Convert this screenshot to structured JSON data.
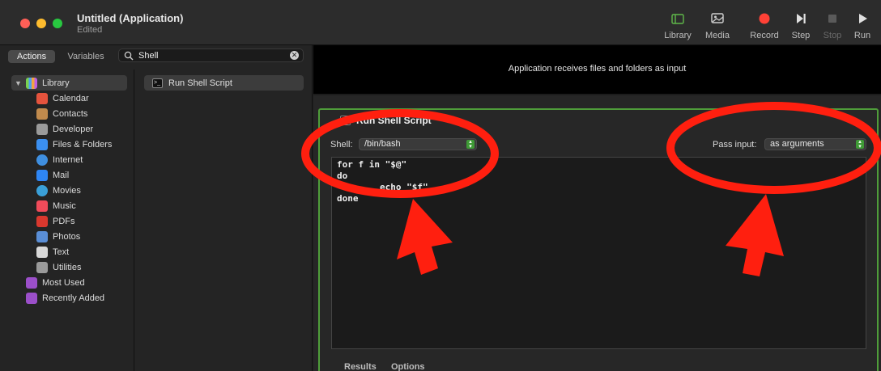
{
  "window": {
    "title": "Untitled (Application)",
    "subtitle": "Edited"
  },
  "toolbar": {
    "items": [
      {
        "label": "Library",
        "icon": "library-icon",
        "enabled": true
      },
      {
        "label": "Media",
        "icon": "media-icon",
        "enabled": true
      },
      {
        "label": "Record",
        "icon": "record-icon",
        "enabled": true
      },
      {
        "label": "Step",
        "icon": "step-icon",
        "enabled": true
      },
      {
        "label": "Stop",
        "icon": "stop-icon",
        "enabled": false
      },
      {
        "label": "Run",
        "icon": "run-icon",
        "enabled": true
      }
    ]
  },
  "left_pane": {
    "tabs": [
      {
        "label": "Actions",
        "active": true
      },
      {
        "label": "Variables",
        "active": false
      }
    ],
    "search": {
      "value": "Shell"
    },
    "library": {
      "root": "Library",
      "items": [
        {
          "label": "Calendar",
          "color": "#e5533d"
        },
        {
          "label": "Contacts",
          "color": "#c08a4d"
        },
        {
          "label": "Developer",
          "color": "#9a9a9a"
        },
        {
          "label": "Files & Folders",
          "color": "#3b8ff0"
        },
        {
          "label": "Internet",
          "color": "#3f8fe0"
        },
        {
          "label": "Mail",
          "color": "#2e86f5"
        },
        {
          "label": "Movies",
          "color": "#3aa0d8"
        },
        {
          "label": "Music",
          "color": "#f04b5a"
        },
        {
          "label": "PDFs",
          "color": "#d9382e"
        },
        {
          "label": "Photos",
          "color": "#5a8ed6"
        },
        {
          "label": "Text",
          "color": "#d8d8d8"
        },
        {
          "label": "Utilities",
          "color": "#9a9a9a"
        }
      ],
      "smart_groups": [
        {
          "label": "Most Used",
          "color": "#9b4fc9"
        },
        {
          "label": "Recently Added",
          "color": "#9b4fc9"
        }
      ]
    },
    "actions": [
      {
        "label": "Run Shell Script"
      }
    ]
  },
  "workflow": {
    "banner": "Application receives files and folders as input",
    "action": {
      "title": "Run Shell Script",
      "shell_label": "Shell:",
      "shell_value": "/bin/bash",
      "pass_input_label": "Pass input:",
      "pass_input_value": "as arguments",
      "code": "for f in \"$@\"\ndo\n\techo \"$f\"\ndone",
      "tabs": [
        "Results",
        "Options"
      ]
    }
  },
  "colors": {
    "accent_green": "#4f9d3a",
    "annotation_red": "#ff1f0f"
  }
}
